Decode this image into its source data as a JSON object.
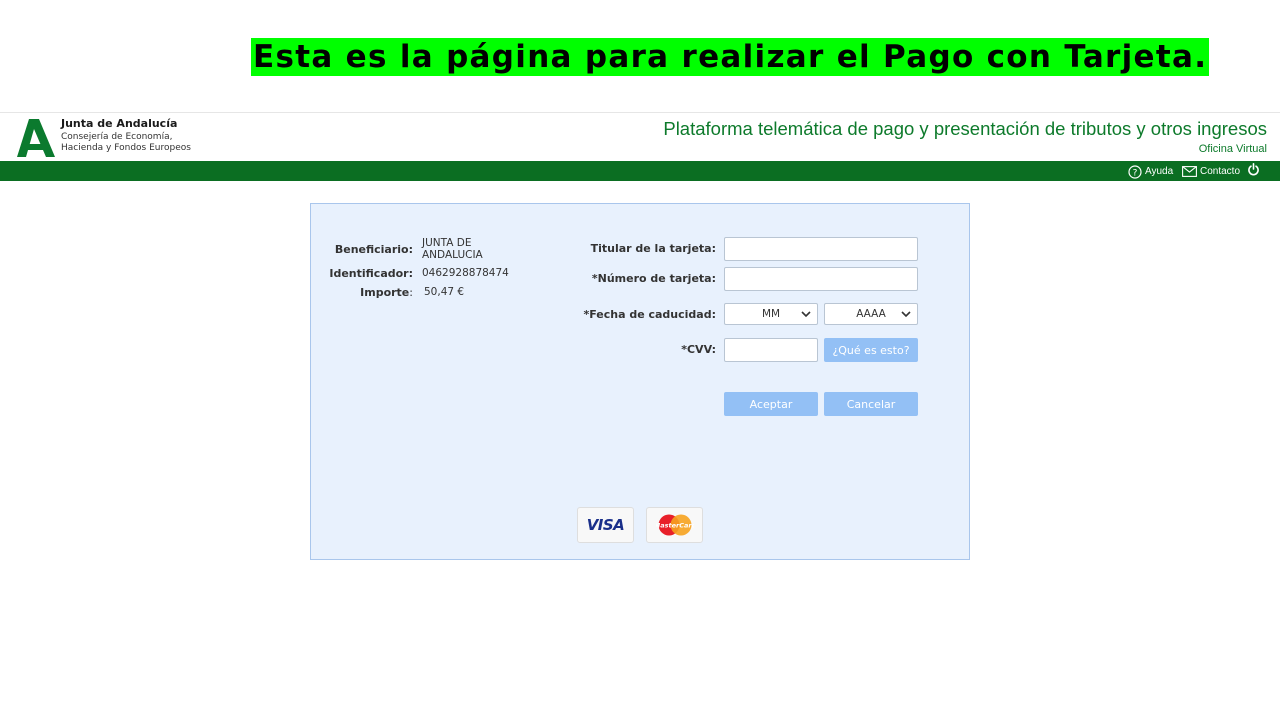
{
  "banner": {
    "text": "Esta es la página para realizar el Pago con Tarjeta."
  },
  "header": {
    "org_name": "Junta de Andalucía",
    "org_sub": "Consejería de Economía,\nHacienda y Fondos Europeos",
    "platform_title": "Plataforma telemática de pago y presentación de tributos y otros ingresos",
    "office": "Oficina Virtual"
  },
  "nav": {
    "help": "Ayuda",
    "contact": "Contacto"
  },
  "colors": {
    "brand_green": "#0b6e22",
    "title_green": "#0d7a2b",
    "banner_bg": "#00ff00",
    "panel_bg": "#e8f1fd",
    "button_bg": "#93c0f5"
  },
  "payment_info": {
    "beneficiary_label": "Beneficiario:",
    "beneficiary_value": "JUNTA DE ANDALUCIA",
    "identifier_label": "Identificador:",
    "identifier_value": "0462928878474",
    "amount_label": "Importe",
    "amount_value": "50,47 €"
  },
  "form": {
    "holder_label": "Titular de la tarjeta:",
    "holder_value": "",
    "number_label": "*Número de tarjeta:",
    "number_value": "",
    "expiry_label": "*Fecha de caducidad:",
    "month_selected": "MM",
    "year_selected": "AAAA",
    "cvv_label": "*CVV:",
    "cvv_value": "",
    "cvv_help": "¿Qué es esto?",
    "accept": "Aceptar",
    "cancel": "Cancelar"
  },
  "cards": {
    "visa": "VISA",
    "mastercard": "MasterCard"
  },
  "icons": [
    "question-circle-icon",
    "envelope-icon",
    "power-icon",
    "chevron-down-icon",
    "junta-andalucia-logo"
  ]
}
